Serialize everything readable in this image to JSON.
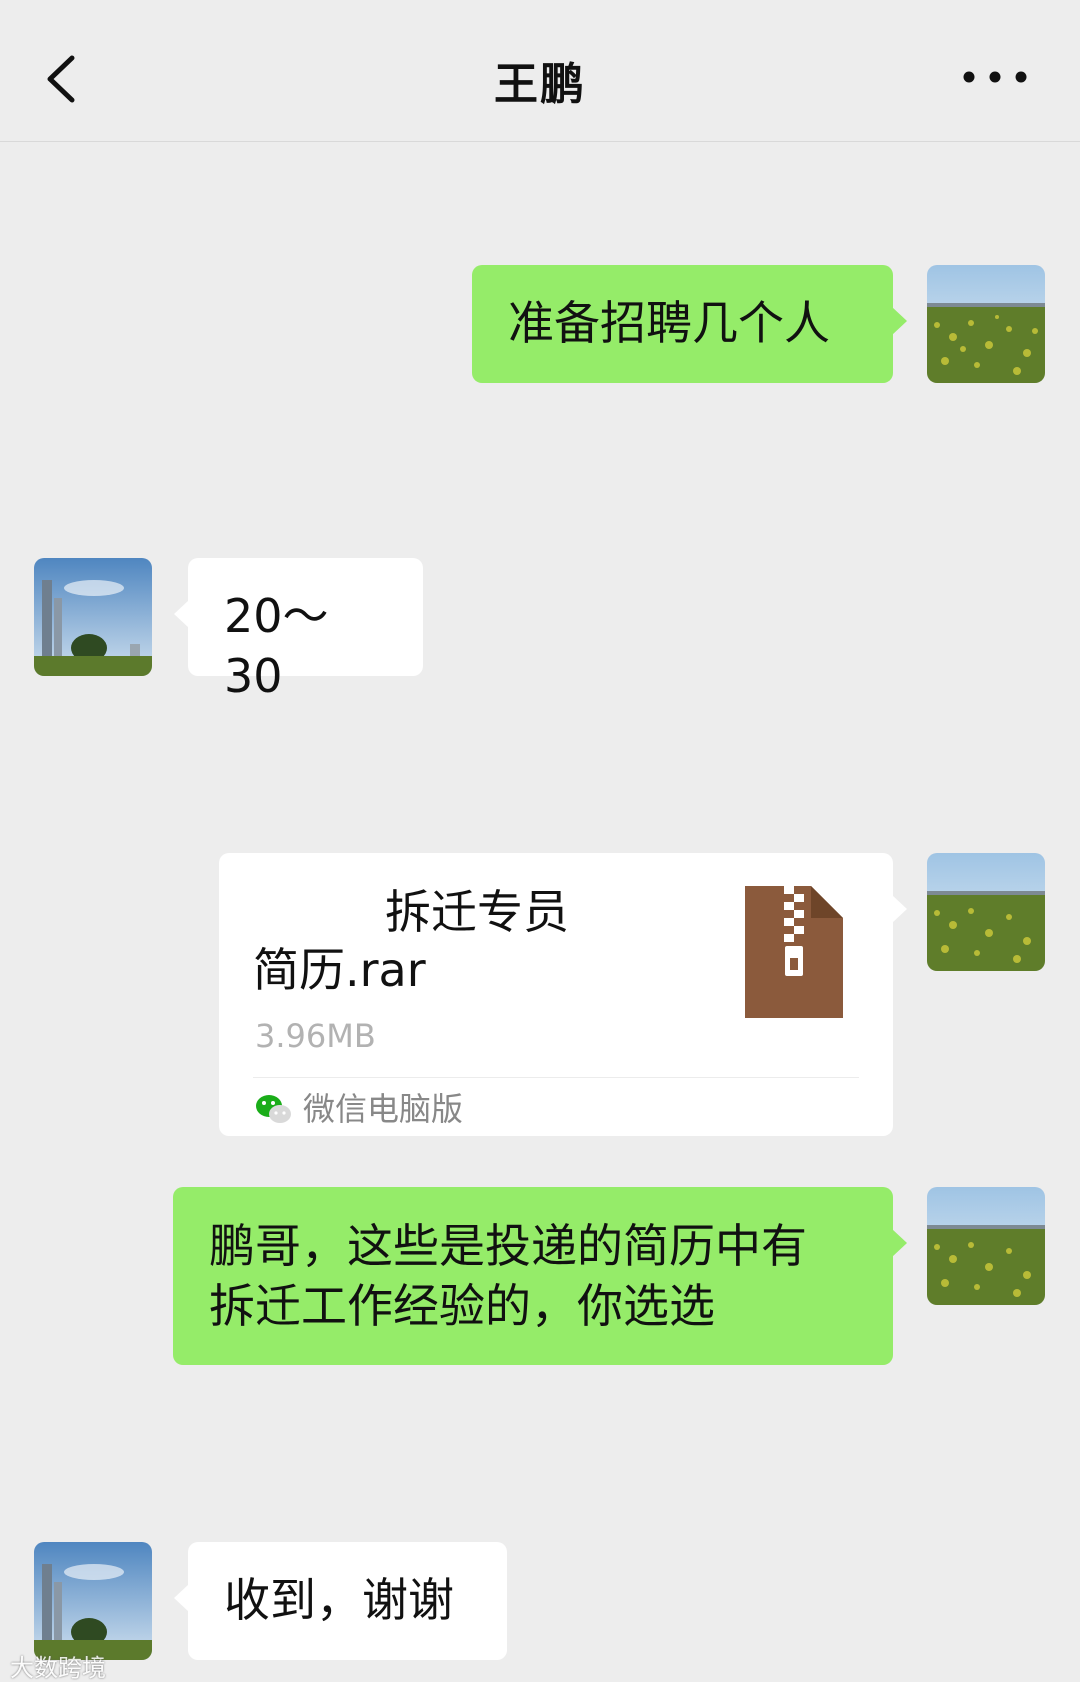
{
  "header": {
    "title": "王鹏",
    "back_icon": "chevron-left-icon",
    "more_icon": "more-dots-icon"
  },
  "messages": [
    {
      "side": "right",
      "type": "text",
      "text": "准备招聘几个人"
    },
    {
      "side": "left",
      "type": "text",
      "text": "20～30"
    },
    {
      "side": "right",
      "type": "file",
      "file_name_line1": "拆迁专员",
      "file_name_line2": "简历.rar",
      "file_size": "3.96MB",
      "source": "微信电脑版"
    },
    {
      "side": "right",
      "type": "text",
      "line1": "鹏哥，这些是投递的简历中有",
      "line2": "拆迁工作经验的，你选选"
    },
    {
      "side": "left",
      "type": "text",
      "text": "收到，谢谢"
    }
  ],
  "colors": {
    "background": "#ededed",
    "sent_bubble": "#95ec69",
    "received_bubble": "#ffffff",
    "file_icon": "#8b5a3c"
  },
  "watermark": "大数跨境"
}
